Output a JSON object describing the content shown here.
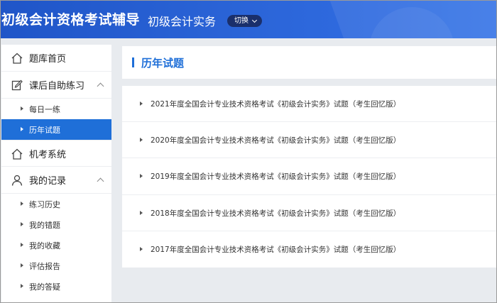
{
  "header": {
    "app_title": "初级会计资格考试辅导",
    "subject": "初级会计实务",
    "switch_label": "切换"
  },
  "sidebar": {
    "items": [
      {
        "label": "题库首页",
        "icon": "home-icon"
      },
      {
        "label": "课后自助练习",
        "icon": "edit-icon",
        "expanded": true,
        "children": [
          "每日一练",
          "历年试题"
        ]
      },
      {
        "label": "机考系统",
        "icon": "home-icon"
      },
      {
        "label": "我的记录",
        "icon": "user-icon",
        "expanded": true,
        "children": [
          "练习历史",
          "我的错题",
          "我的收藏",
          "评估报告",
          "我的答疑"
        ]
      }
    ],
    "active_child": "历年试题"
  },
  "main": {
    "title": "历年试题",
    "papers": [
      "2021年度全国会计专业技术资格考试《初级会计实务》试题（考生回忆版）",
      "2020年度全国会计专业技术资格考试《初级会计实务》试题（考生回忆版）",
      "2019年度全国会计专业技术资格考试《初级会计实务》试题（考生回忆版）",
      "2018年度全国会计专业技术资格考试《初级会计实务》试题（考生回忆版）",
      "2017年度全国会计专业技术资格考试《初级会计实务》试题（考生回忆版）"
    ]
  },
  "colors": {
    "accent": "#1f6fd8",
    "header_bg": "#2a63d6",
    "switch_bg": "#1a2f6b"
  }
}
